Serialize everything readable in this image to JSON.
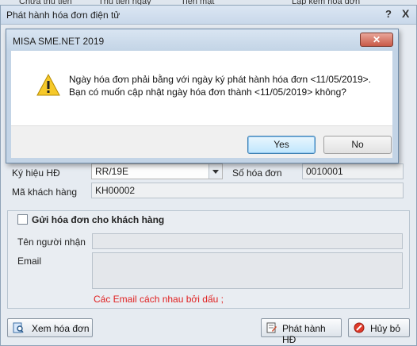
{
  "background": {
    "partial_labels": [
      "Chưa thu tiền",
      "Thu tiền ngay",
      "Tiền mặt",
      "Lập kèm hóa đơn"
    ]
  },
  "main_dialog": {
    "title": "Phát hành hóa đơn điện tử",
    "help_label": "?",
    "close_label": "X",
    "form": {
      "invoice_symbol_label": "Ký hiệu HĐ",
      "invoice_symbol_value": "RR/19E",
      "invoice_number_label": "Số hóa đơn",
      "invoice_number_value": "0010001",
      "customer_code_label": "Mã khách hàng",
      "customer_code_value": "KH00002"
    },
    "send_group": {
      "checkbox_label": "Gửi hóa đơn cho khách hàng",
      "recipient_label": "Tên người nhận",
      "recipient_value": "",
      "email_label": "Email",
      "email_value": "",
      "email_hint": "Các Email cách nhau bởi dấu ;"
    },
    "buttons": {
      "view_invoice": "Xem hóa đơn",
      "issue": "Phát hành HĐ",
      "cancel": "Hủy bỏ"
    }
  },
  "message_box": {
    "title": "MISA SME.NET 2019",
    "line1": "Ngày hóa đơn phải bằng với ngày ký phát hành hóa đơn <11/05/2019>.",
    "line2": "Bạn có muốn cập nhật ngày hóa đơn thành <11/05/2019> không?",
    "yes_label": "Yes",
    "no_label": "No"
  },
  "icons": {
    "warning": "warning-icon",
    "view": "view-invoice-icon",
    "issue": "issue-invoice-icon",
    "cancel": "cancel-icon"
  }
}
